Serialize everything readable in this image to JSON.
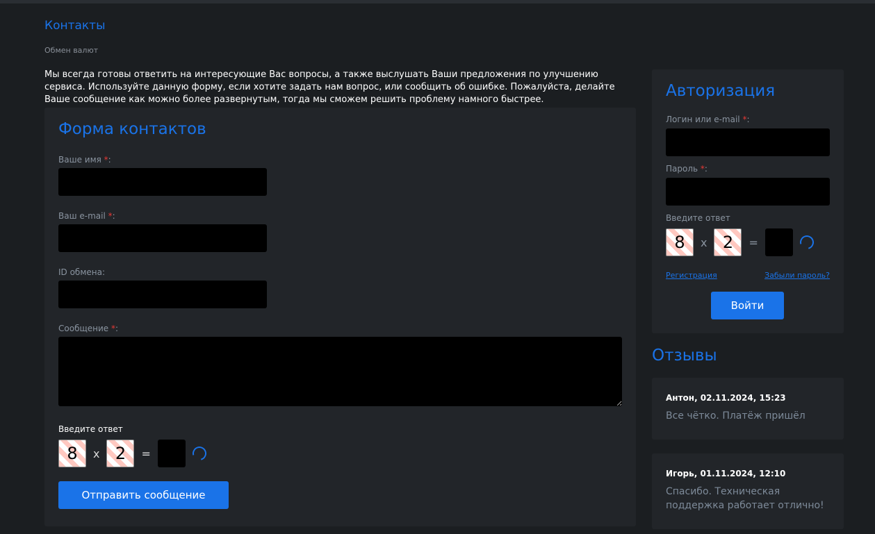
{
  "page": {
    "title": "Контакты",
    "breadcrumb": "Обмен валют",
    "intro": "Мы всегда готовы ответить на интересующие Вас вопросы, а также выслушать Ваши предложения по улучшению сервиса. Используйте данную форму, если хотите задать нам вопрос, или сообщить об ошибке. Пожалуйста, делайте Ваше сообщение как можно более развернутым, тогда мы сможем решить проблему намного быстрее."
  },
  "contact_form": {
    "title": "Форма контактов",
    "name_label": "Ваше имя",
    "email_label": "Ваш e-mail",
    "exchange_id_label": "ID обмена:",
    "message_label": "Сообщение",
    "required_mark": "*",
    "colon": ":",
    "captcha_label": "Введите ответ",
    "captcha_a": "8",
    "captcha_op": "x",
    "captcha_b": "2",
    "captcha_eq": "=",
    "submit": "Отправить сообщение"
  },
  "auth": {
    "title": "Авторизация",
    "login_label": "Логин или e-mail",
    "password_label": "Пароль",
    "captcha_label": "Введите ответ",
    "captcha_a": "8",
    "captcha_op": "x",
    "captcha_b": "2",
    "captcha_eq": "=",
    "register": "Регистрация",
    "forgot": "Забыли пароль?",
    "login_button": "Войти"
  },
  "reviews": {
    "title": "Отзывы",
    "items": [
      {
        "author": "Антон, 02.11.2024, 15:23",
        "text": "Все чётко. Платёж пришёл"
      },
      {
        "author": "Игорь, 01.11.2024, 12:10",
        "text": "Спасибо. Техническая поддержка работает отлично!"
      }
    ]
  }
}
